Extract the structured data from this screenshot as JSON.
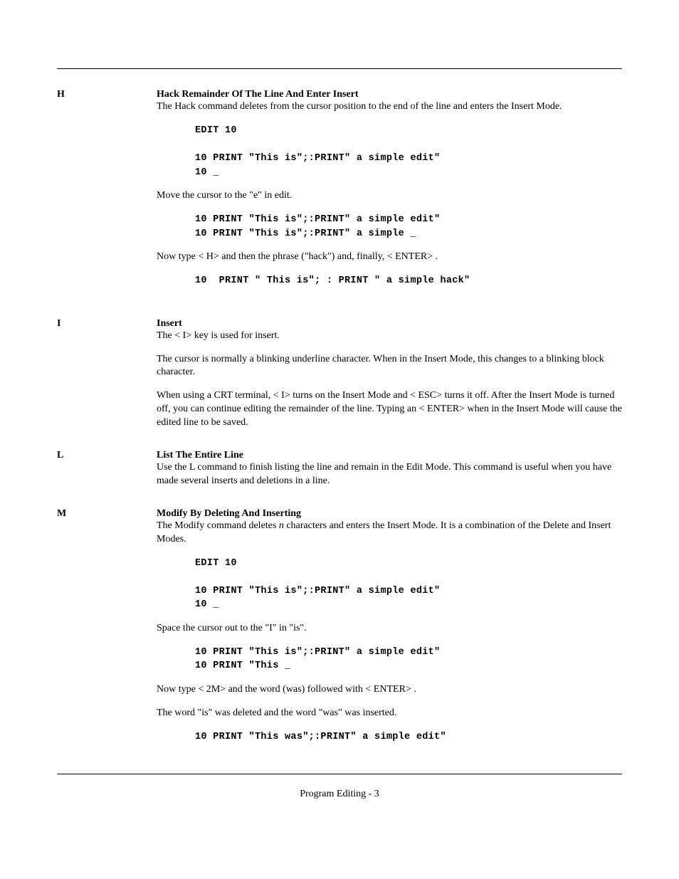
{
  "footer": "Program Editing - 3",
  "sections": {
    "H": {
      "key": "H",
      "title": "Hack Remainder Of The Line And Enter Insert",
      "p1": "The Hack command deletes from the cursor position to the end of the line and enters the Insert Mode.",
      "code1_l1": "EDIT 10",
      "code1_l2": "",
      "code1_l3": "10 PRINT \"This is\";:PRINT\" a simple edit\"",
      "code1_l4": "10 _",
      "p2": "Move the cursor to the \"e\" in edit.",
      "code2_l1": "10 PRINT \"This is\";:PRINT\" a simple edit\"",
      "code2_l2": "10 PRINT \"This is\";:PRINT\" a simple _",
      "p3": "Now type < H>  and then the phrase (\"hack\") and, finally, < ENTER> .",
      "code3_l1": "10  PRINT \" This is\"; : PRINT \" a simple hack\""
    },
    "I": {
      "key": "I",
      "title": "Insert",
      "p1": "The < I>  key is used for insert.",
      "p2": "The cursor is normally a blinking underline character.  When in the Insert Mode, this changes to a blinking block character.",
      "p3": "When using a CRT terminal, < I>  turns on the Insert Mode and < ESC>  turns it off.  After the Insert Mode is turned off, you can continue editing the remainder of the line.  Typing an < ENTER>  when in the Insert Mode will cause the edited line to be saved."
    },
    "L": {
      "key": "L",
      "title": "List The Entire Line",
      "p1": "Use the L command to finish listing the line and remain in the Edit Mode.  This command is useful when you have made several inserts and deletions in a line."
    },
    "M": {
      "key": "M",
      "title": "Modify By Deleting And Inserting",
      "p1a": "The Modify command deletes ",
      "p1n": "n",
      "p1b": " characters and enters the Insert Mode.  It is a combination of the Delete and Insert Modes.",
      "code1_l1": "EDIT 10",
      "code1_l2": "",
      "code1_l3": "10 PRINT \"This is\";:PRINT\" a simple edit\"",
      "code1_l4": "10 _",
      "p2": "Space the cursor out to the \"I\" in \"is\".",
      "code2_l1": "10 PRINT \"This is\";:PRINT\" a simple edit\"",
      "code2_l2": "10 PRINT \"This _",
      "p3": "Now type < 2M>  and the word (was) followed with < ENTER> .",
      "p4": "The word \"is\" was deleted and the word \"was\" was inserted.",
      "code3_l1": "10 PRINT \"This was\";:PRINT\" a simple edit\""
    }
  }
}
